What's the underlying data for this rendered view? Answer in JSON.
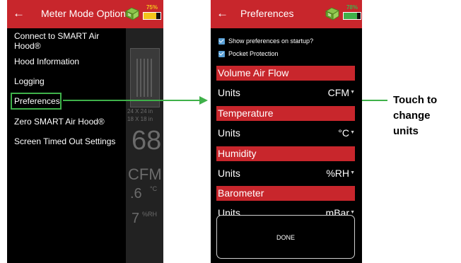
{
  "left_phone": {
    "title": "Meter Mode Options",
    "back_icon": "arrow-left-icon",
    "hood_icon": "hood-icon",
    "battery": {
      "percent_label": "75%",
      "level": 0.75,
      "fill_color": "#f2c41b",
      "label_color": "#f2c41b"
    },
    "menu": [
      {
        "label_line1": "Connect to SMART Air",
        "label_line2": "Hood®"
      },
      {
        "label": "Hood Information"
      },
      {
        "label": "Logging"
      },
      {
        "label": "Preferences"
      },
      {
        "label": "Zero SMART Air Hood®"
      },
      {
        "label": "Screen Timed Out Settings"
      }
    ],
    "background_meter": {
      "size_line1": "24 X 24 in",
      "size_line2": "18 X 18 in",
      "reading": "68",
      "unit": "CFM",
      "temp_value": ".6",
      "temp_unit": "°C",
      "rh_value": "7",
      "rh_unit": "%RH"
    }
  },
  "right_phone": {
    "title": "Preferences",
    "back_icon": "arrow-left-icon",
    "hood_icon": "hood-icon",
    "battery": {
      "percent_label": "78%",
      "level": 0.78,
      "fill_color": "#3fb14a",
      "label_color": "#3fb14a"
    },
    "checkboxes": [
      {
        "label": "Show preferences on startup?",
        "checked": true
      },
      {
        "label": "Pocket Protection",
        "checked": true
      }
    ],
    "sections": [
      {
        "title": "Volume Air Flow",
        "units_label": "Units",
        "units_value": "CFM"
      },
      {
        "title": "Temperature",
        "units_label": "Units",
        "units_value": "°C"
      },
      {
        "title": "Humidity",
        "units_label": "Units",
        "units_value": "%RH"
      },
      {
        "title": "Barometer",
        "units_label": "Units",
        "units_value": "mBar"
      }
    ],
    "done_button": "DONE"
  },
  "annotation": {
    "line1": "Touch to",
    "line2": "change",
    "line3": "units"
  },
  "colors": {
    "header_red": "#c8262c",
    "highlight_green": "#3fb14a",
    "checkbox_blue": "#5aa0d6"
  }
}
